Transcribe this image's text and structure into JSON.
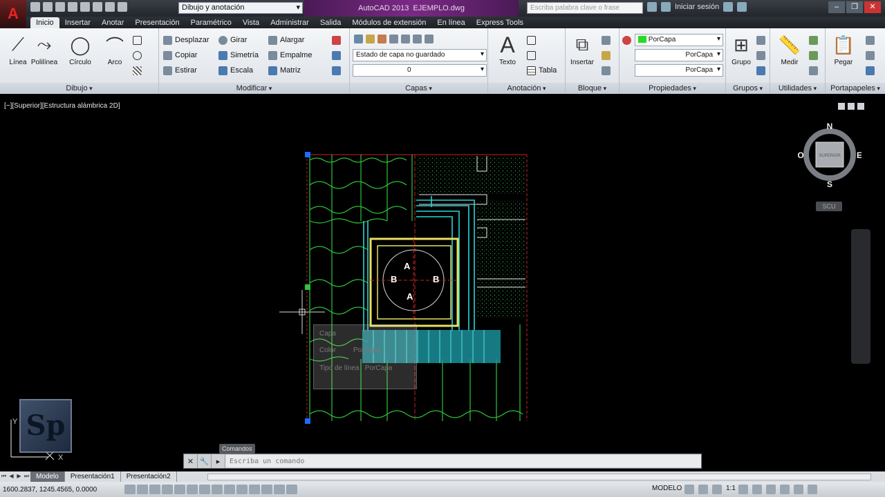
{
  "title_bar": {
    "app_letter": "A",
    "workspace": "Dibujo y anotación",
    "app_name": "AutoCAD 2013",
    "file_name": "EJEMPLO.dwg",
    "search_placeholder": "Escriba palabra clave o frase",
    "signin": "Iniciar sesión"
  },
  "tabs": [
    "Inicio",
    "Insertar",
    "Anotar",
    "Presentación",
    "Paramétrico",
    "Vista",
    "Administrar",
    "Salida",
    "Módulos de extensión",
    "En línea",
    "Express Tools"
  ],
  "ribbon": {
    "dibujo": {
      "label": "Dibujo",
      "tools": [
        "Línea",
        "Polilínea",
        "Círculo",
        "Arco"
      ]
    },
    "modificar": {
      "label": "Modificar",
      "tools": [
        "Desplazar",
        "Girar",
        "Alargar",
        "Copiar",
        "Simetría",
        "Empalme",
        "Estirar",
        "Escala",
        "Matriz"
      ]
    },
    "capas": {
      "label": "Capas",
      "state": "Estado de capa no guardado",
      "current": "0"
    },
    "anotacion": {
      "label": "Anotación",
      "tools": [
        "Texto",
        "Tabla"
      ]
    },
    "bloque": {
      "label": "Bloque",
      "insert": "Insertar"
    },
    "propiedades": {
      "label": "Propiedades",
      "color": "PorCapa",
      "linetype": "PorCapa",
      "lineweight": "PorCapa"
    },
    "grupos": {
      "label": "Grupos",
      "tool": "Grupo"
    },
    "utilidades": {
      "label": "Utilidades",
      "tool": "Medir"
    },
    "portapapeles": {
      "label": "Portapapeles",
      "tool": "Pegar"
    }
  },
  "viewport": {
    "label": "[−][Superior][Estructura alámbrica 2D]",
    "compass": {
      "n": "N",
      "s": "S",
      "e": "E",
      "w": "O",
      "cube": "SUPERIOR"
    },
    "wcs": "SCU",
    "labels": {
      "a_top": "A",
      "a_bottom": "A",
      "b_left": "B",
      "b_right": "B"
    },
    "tooltip": {
      "layer_key": "Capa",
      "color_key": "Color",
      "color_val": "PorCapa",
      "linetype_key": "Tipo de línea",
      "linetype_val": "PorCapa"
    },
    "ucs": {
      "x": "X",
      "y": "Y"
    },
    "logo": "Sp"
  },
  "command": {
    "tooltip": "Comandos",
    "placeholder": "Escriba un comando"
  },
  "layout_tabs": [
    "Modelo",
    "Presentación1",
    "Presentación2"
  ],
  "status": {
    "coords": "1600.2837, 1245.4565, 0.0000",
    "modelo": "MODELO",
    "scale": "1:1"
  }
}
